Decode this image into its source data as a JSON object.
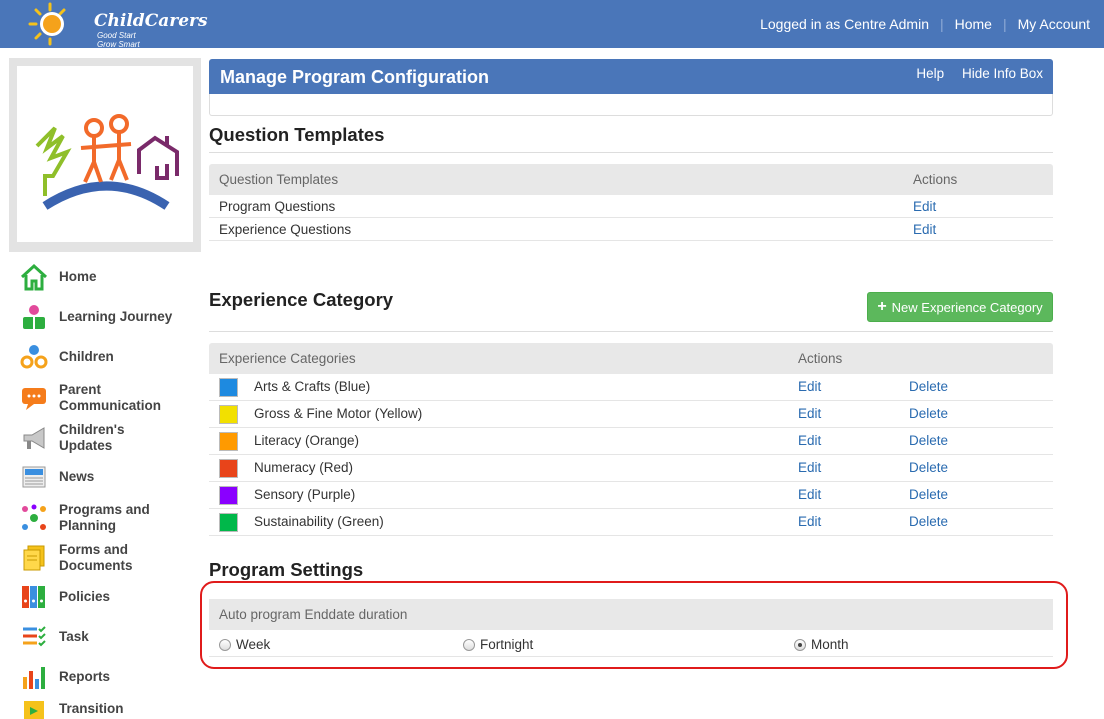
{
  "header": {
    "brand": "ChildCarers",
    "tagline": "Good Start Grow Smart",
    "logged_in": "Logged in as Centre Admin",
    "home": "Home",
    "account": "My Account"
  },
  "sidebar": {
    "items": [
      {
        "label": "Home",
        "icon": "home-icon"
      },
      {
        "label": "Learning Journey",
        "icon": "learning-journey-icon"
      },
      {
        "label": "Children",
        "icon": "children-icon"
      },
      {
        "label": "Parent Communication",
        "icon": "chat-icon"
      },
      {
        "label": "Children's Updates",
        "icon": "megaphone-icon"
      },
      {
        "label": "News",
        "icon": "news-icon"
      },
      {
        "label": "Programs and Planning",
        "icon": "mindmap-icon"
      },
      {
        "label": "Forms and Documents",
        "icon": "documents-icon"
      },
      {
        "label": "Policies",
        "icon": "binders-icon"
      },
      {
        "label": "Task",
        "icon": "checklist-icon"
      },
      {
        "label": "Reports",
        "icon": "bar-chart-icon"
      },
      {
        "label": "Transition",
        "icon": "transition-icon"
      }
    ]
  },
  "panel": {
    "title": "Manage Program Configuration",
    "help": "Help",
    "hide_info": "Hide Info Box"
  },
  "question_templates": {
    "title": "Question Templates",
    "col_name": "Question Templates",
    "col_actions": "Actions",
    "rows": [
      {
        "name": "Program Questions",
        "edit": "Edit"
      },
      {
        "name": "Experience Questions",
        "edit": "Edit"
      }
    ]
  },
  "experience_category": {
    "title": "Experience Category",
    "new_button": "New Experience Category",
    "col_name": "Experience Categories",
    "col_actions": "Actions",
    "rows": [
      {
        "name": "Arts & Crafts (Blue)",
        "color": "#1e8ae0",
        "edit": "Edit",
        "delete": "Delete"
      },
      {
        "name": "Gross & Fine Motor (Yellow)",
        "color": "#f2e000",
        "edit": "Edit",
        "delete": "Delete"
      },
      {
        "name": "Literacy (Orange)",
        "color": "#ff9a00",
        "edit": "Edit",
        "delete": "Delete"
      },
      {
        "name": "Numeracy (Red)",
        "color": "#e8441a",
        "edit": "Edit",
        "delete": "Delete"
      },
      {
        "name": "Sensory (Purple)",
        "color": "#8a00ff",
        "edit": "Edit",
        "delete": "Delete"
      },
      {
        "name": "Sustainability (Green)",
        "color": "#00b84a",
        "edit": "Edit",
        "delete": "Delete"
      }
    ]
  },
  "program_settings": {
    "title": "Program Settings",
    "field_label": "Auto program Enddate duration",
    "options": [
      {
        "label": "Week",
        "selected": false
      },
      {
        "label": "Fortnight",
        "selected": false
      },
      {
        "label": "Month",
        "selected": true
      }
    ]
  }
}
